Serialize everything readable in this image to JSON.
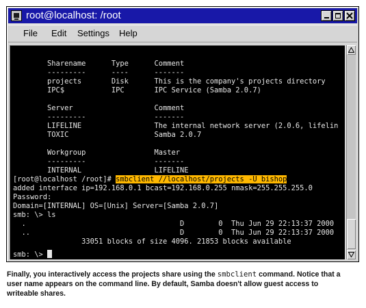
{
  "window": {
    "title": "root@localhost: /root"
  },
  "menu": [
    "File",
    "Edit",
    "Settings",
    "Help"
  ],
  "terminal": {
    "lines": [
      "        Sharename      Type      Comment",
      "        ---------      ----      -------",
      "        projects       Disk      This is the company's projects directory",
      "        IPC$           IPC       IPC Service (Samba 2.0.7)",
      "",
      "        Server                   Comment",
      "        ---------                -------",
      "        LIFELINE                 The internal network server (2.0.6, lifelin",
      "        TOXIC                    Samba 2.0.7",
      "",
      "        Workgroup                Master",
      "        ---------                -------",
      "        INTERNAL                 LIFELINE",
      "",
      "added interface ip=192.168.0.1 bcast=192.168.0.255 nmask=255.255.255.0",
      "Password:",
      "Domain=[INTERNAL] OS=[Unix] Server=[Samba 2.0.7]",
      "smb: \\> ls",
      "  .                                    D        0  Thu Jun 29 22:13:37 2000",
      "  ..                                   D        0  Thu Jun 29 22:13:37 2000",
      "",
      "                33051 blocks of size 4096. 21853 blocks available",
      "smb: \\> "
    ],
    "command_prompt": "[root@localhost /root]# ",
    "command_highlighted": "smbclient //localhost/projects -U bishop",
    "highlight_color": "#ffb800"
  },
  "caption": {
    "part1": "Finally, you interactively access the projects share using the ",
    "code": "smbclient",
    "part2": " command. Notice that a user name appears on the command line. By default, Samba doesn't allow guest access to writeable shares."
  },
  "colors": {
    "titlebar": "#1818a8",
    "terminal_bg": "#000000",
    "terminal_fg": "#e8e8e8"
  },
  "icons": {
    "title": "terminal-icon",
    "minimize": "minimize-icon",
    "maximize": "maximize-icon",
    "close": "close-icon",
    "scroll_up": "arrow-up-icon",
    "scroll_down": "arrow-down-icon"
  }
}
